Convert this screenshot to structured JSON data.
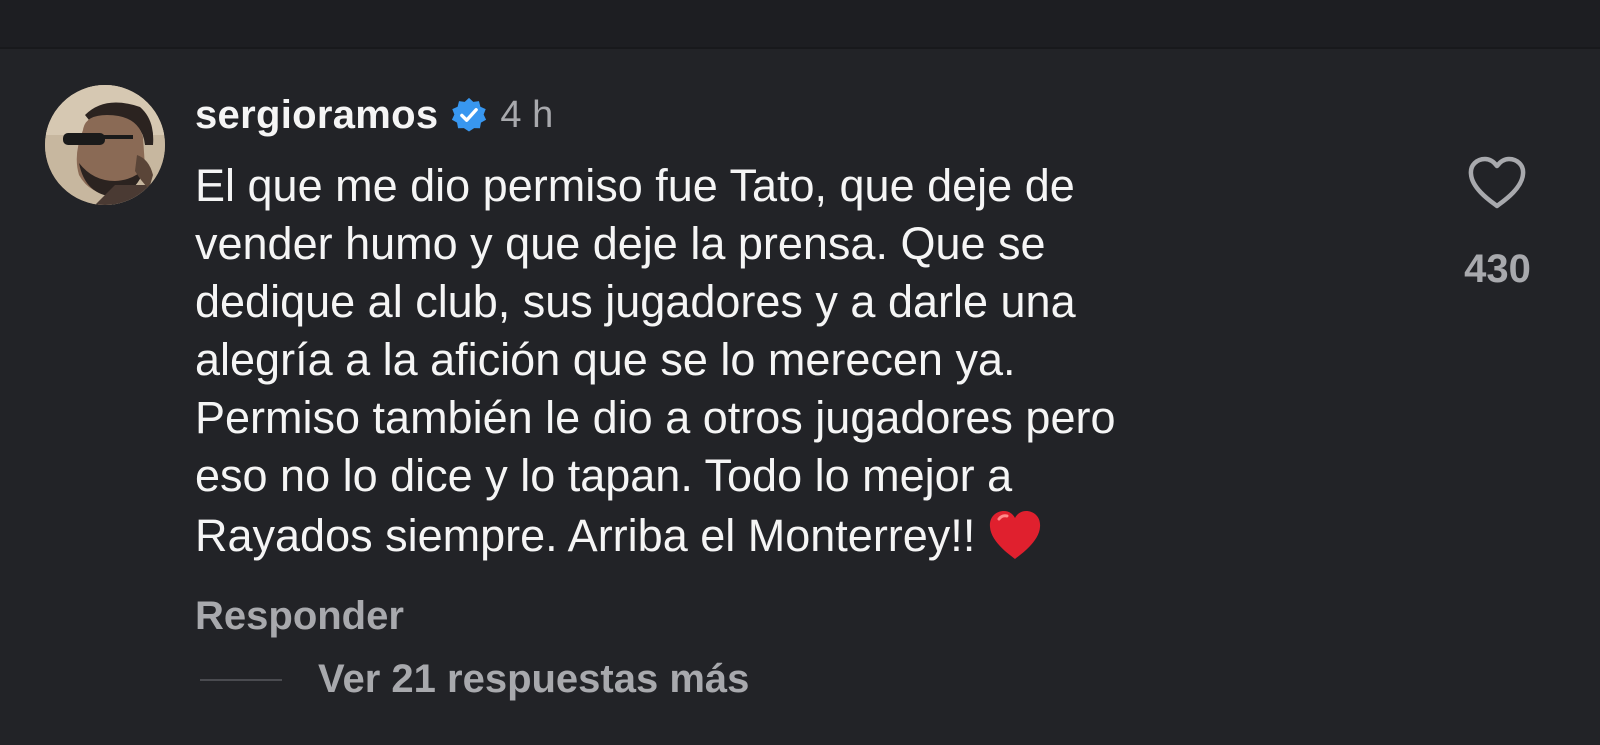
{
  "comment": {
    "username": "sergioramos",
    "verified_icon": "verified-badge-icon",
    "time_ago": "4 h",
    "text": "El que me dio permiso fue Tato, que deje de\nvender humo y que deje la prensa.  Que se\ndedique al club, sus jugadores y a darle una\nalegría a la afición que se lo merecen ya.\nPermiso también le dio a otros jugadores pero\neso no lo dice y lo tapan.  Todo lo mejor a\nRayados siempre. Arriba el Monterrey!!",
    "emoji": "red-heart-emoji",
    "like_icon": "heart-outline-icon",
    "like_count": "430",
    "reply_label": "Responder",
    "more_replies_label": "Ver 21 respuestas más"
  },
  "colors": {
    "background": "#222327",
    "primary_text": "#f5f5f5",
    "secondary_text": "#a8a9ad",
    "verified_blue": "#3897f0",
    "emoji_red": "#e0202e"
  }
}
